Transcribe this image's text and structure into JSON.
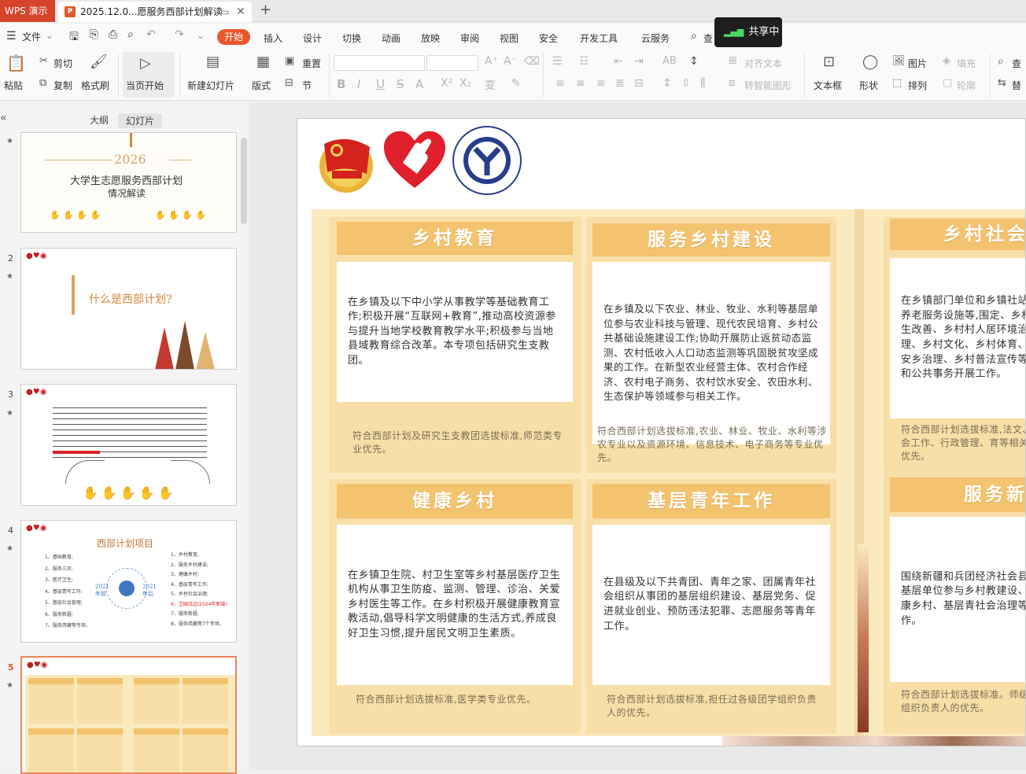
{
  "titlebar": {
    "app_name": "WPS 演示",
    "doc_tab_title": "2025.12.0...愿服务西部计划解读",
    "new_tab_symbol": "+"
  },
  "menubar": {
    "file": "文件",
    "items": [
      "开始",
      "插入",
      "设计",
      "切换",
      "动画",
      "放映",
      "审阅",
      "视图",
      "安全",
      "开发工具",
      "云服务"
    ],
    "search_stub": "查",
    "share_label": "共享中"
  },
  "ribbon": {
    "paste": "粘贴",
    "cut": "剪切",
    "copy": "复制",
    "format_painter": "格式刷",
    "play_from_current": "当页开始",
    "new_slide": "新建幻灯片",
    "layout": "版式",
    "reset": "重置",
    "section": "节",
    "align_text": "对齐文本",
    "smart_graphic": "转智能图形",
    "textbox": "文本框",
    "shape": "形状",
    "picture": "图片",
    "arrange": "排列",
    "fill": "填充",
    "outline": "轮廓",
    "find_stub": "查",
    "replace_stub": "替"
  },
  "leftpane": {
    "tab_outline": "大纲",
    "tab_slides": "幻灯片",
    "collapse_icon": "«",
    "slide1": {
      "year": "2026",
      "title_line1": "大学生志愿服务西部计划",
      "title_line2": "情况解读"
    },
    "slide2": {
      "number": "2",
      "title": "什么是西部计划?"
    },
    "slide3": {
      "number": "3"
    },
    "slide4": {
      "number": "4",
      "title": "西部计划项目",
      "left_items": [
        "1、基础教育;",
        "2、服务三农;",
        "3、医疗卫生;",
        "4、基层青年工作;",
        "5、基层社会管理;",
        "6、服务新疆;",
        "7、服务西藏等专项。"
      ],
      "right_items": [
        "1、乡村教育;",
        "2、服务乡村建设;",
        "3、健康乡村;",
        "4、基层青年工作;",
        "5、乡村社会治理;",
        "6、卫国戍边(2024年新增)",
        "7、服务新疆;",
        "8、服务西藏等7个专项。"
      ],
      "year_left": "2021年前",
      "year_right": "2021年后"
    },
    "slide5": {
      "number": "5"
    }
  },
  "slide": {
    "cards": [
      {
        "title": "乡村教育",
        "body": "在乡镇及以下中小学从事教学等基础教育工作;积极开展“互联网+教育”,推动高校资源参与提升当地学校教育教学水平;积极参与当地县域教育综合改革。本专项包括研究生支教团。",
        "foot": "符合西部计划及研究生支教团选拔标准,师范类专业优先。"
      },
      {
        "title": "服务乡村建设",
        "body": "在乡镇及以下农业、林业、牧业、水利等基层单位参与农业科技与管理、现代农民培育、乡村公共基础设施建设工作;协助开展防止返贫动态监测、农村低收入人口动态监测等巩固脱贫攻坚成果的工作。在新型农业经营主体、农村合作经济、农村电子商务、农村饮水安全、农田水利、生态保护等领域参与相关工作。",
        "foot": "符合西部计划选拔标准,农业、林业、牧业、水利等涉农专业以及资源环境、信息技术、电子商务等专业优先。"
      },
      {
        "title": "乡村社会",
        "body": "在乡镇部门单位和乡镇社站、养老服务设施等,围定、乡村民生改善、乡村村人居环境治理、乡村文化、乡村体育、平安乡治理、乡村普法宣传等务和公共事务开展工作。",
        "foot": "符合西部计划选拔标准,法文、社会工作、行政管理、育等相关专业优先。"
      },
      {
        "title": "健康乡村",
        "body": "在乡镇卫生院、村卫生室等乡村基层医疗卫生机构从事卫生防疫、监测、管理、诊治、关爱乡村医生等工作。在乡村积极开展健康教育宣教活动,倡导科学文明健康的生活方式,养成良好卫生习惯,提升居民文明卫生素质。",
        "foot": "符合西部计划选拔标准,医学类专业优先。"
      },
      {
        "title": "基层青年工作",
        "body": "在县级及以下共青团、青年之家、团属青年社会组织从事团的基层组织建设、基层党务、促进就业创业、预防违法犯罪、志愿服务等青年工作。",
        "foot": "符合西部计划选拔标准,担任过各级团学组织负责人的优先。"
      },
      {
        "title": "服务新",
        "body": "围绕新疆和兵团经济社会县乡基层单位参与乡村教建设、健康乡村、基层青社会治理等工作。",
        "foot": "符合西部计划选拔标准。师级团学组织负责人的优先。"
      }
    ]
  },
  "colors": {
    "accent": "#e8572a",
    "wps_red": "#d6452b",
    "card_title": "#f3c36f",
    "card_bg": "#f8dfa7",
    "slide_bg": "#fbe9bf"
  }
}
